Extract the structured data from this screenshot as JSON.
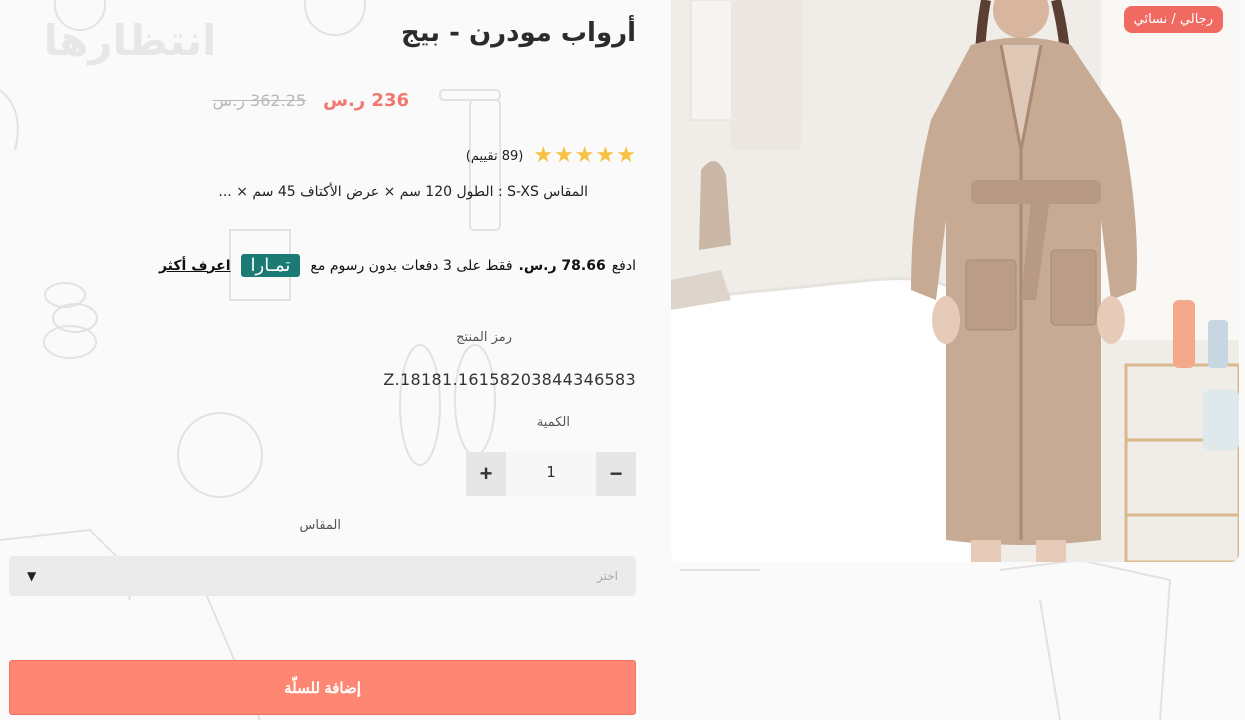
{
  "watermark": "انتظارها",
  "product": {
    "category": "رجالي  /  نسائي",
    "title": "أرواب مودرن - بيج",
    "price_current": "236 ر.س",
    "price_old": "362.25 ر.س",
    "rating_stars": 5,
    "rating_count": "(89 تقييم)",
    "description": "المقاس S-XS : الطول 120 سم × عرض الأكتاف 45 سم × ..."
  },
  "tamara": {
    "prefix": "ادفع",
    "amount": "78.66 ر.س.",
    "suffix": "فقط على 3 دفعات بدون رسوم مع",
    "logo_text": "تمـارا",
    "learn_more": "اعرف أكثر"
  },
  "sku": {
    "label": "رمز المنتج",
    "value": "Z.18181.16158203844346583"
  },
  "quantity": {
    "label": "الكمية",
    "value": "1",
    "plus": "+",
    "minus": "−"
  },
  "size": {
    "label": "المقاس",
    "placeholder": "اختر"
  },
  "add_to_cart": "إضافة للسلّة",
  "colors": {
    "accent": "#fd8773",
    "badge": "#f06a62",
    "star": "#f7c243",
    "tamara": "#1b7a74"
  }
}
